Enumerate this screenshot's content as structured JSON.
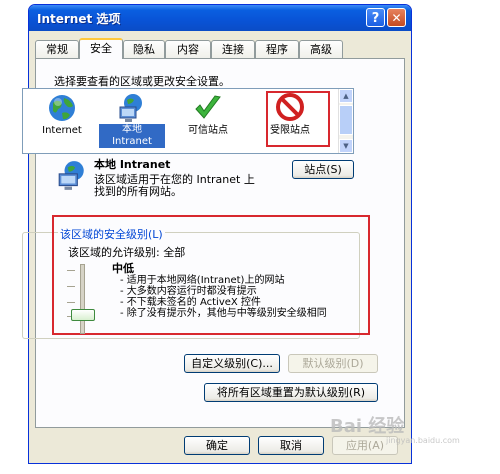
{
  "window": {
    "title": "Internet 选项",
    "help_glyph": "?",
    "close_glyph": "✕"
  },
  "tabs": [
    {
      "label": "常规"
    },
    {
      "label": "安全",
      "active": true
    },
    {
      "label": "隐私"
    },
    {
      "label": "内容"
    },
    {
      "label": "连接"
    },
    {
      "label": "程序"
    },
    {
      "label": "高级"
    }
  ],
  "security": {
    "instruction": "选择要查看的区域或更改安全设置。",
    "zones": [
      {
        "label": "Internet",
        "icon": "globe-icon"
      },
      {
        "label_line1": "本地",
        "label_line2": "Intranet",
        "icon": "local-intranet-icon",
        "selected": true
      },
      {
        "label": "可信站点",
        "icon": "checkmark-icon"
      },
      {
        "label": "受限站点",
        "icon": "restricted-icon",
        "highlighted": true
      }
    ],
    "selected_zone": {
      "name": "本地 Intranet",
      "desc_line1": "该区域适用于在您的 Intranet 上",
      "desc_line2": "找到的所有网站。",
      "sites_button": "站点(S)"
    },
    "level": {
      "group_title": "该区域的安全级别(L)",
      "allowed_text": "该区域的允许级别: 全部",
      "level_name": "中低",
      "bullets": [
        "- 适用于本地网络(Intranet)上的网站",
        "- 大多数内容运行时都没有提示",
        "- 不下载未签名的 ActiveX 控件",
        "- 除了没有提示外，其他与中等级别安全级相同"
      ]
    },
    "custom_button": "自定义级别(C)...",
    "default_button": "默认级别(D)",
    "reset_all_button": "将所有区域重置为默认级别(R)"
  },
  "footer": {
    "ok": "确定",
    "cancel": "取消",
    "apply": "应用(A)"
  },
  "watermark": {
    "text": "Bai 经验",
    "sub": "jingyan.baidu.com"
  },
  "colors": {
    "title_blue": "#0a5fe0",
    "highlight_red": "#d8282e",
    "selection_blue": "#316ac5"
  }
}
